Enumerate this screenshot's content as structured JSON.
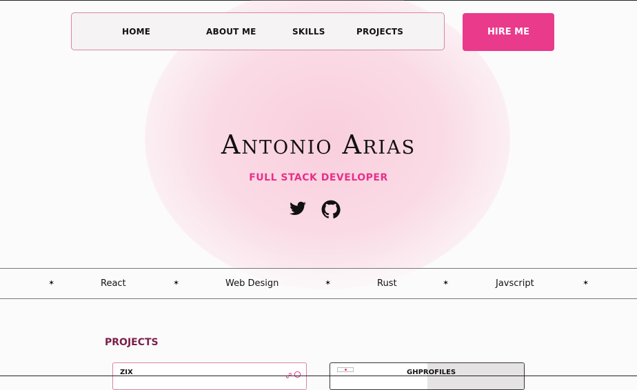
{
  "nav": {
    "items": [
      {
        "label": "HOME"
      },
      {
        "label": "ABOUT ME"
      },
      {
        "label": "SKILLS"
      },
      {
        "label": "PROJECTS"
      }
    ],
    "hire_label": "HIRE ME"
  },
  "hero": {
    "name": "Antonio Arias",
    "role": "FULL STACK DEVELOPER",
    "social": [
      {
        "icon": "twitter-icon"
      },
      {
        "icon": "github-icon"
      }
    ]
  },
  "ticker": {
    "items": [
      "React",
      "Web Design",
      "Rust",
      "Javscript"
    ],
    "separator": "✶"
  },
  "projects": {
    "title": "PROJECTS",
    "cards": [
      {
        "title": "ZIX"
      },
      {
        "title": "GHPROFILES"
      }
    ]
  },
  "colors": {
    "accent": "#e93a8c",
    "role": "#e8308a",
    "section": "#7a1f4a",
    "nav_border": "#d9859c"
  }
}
